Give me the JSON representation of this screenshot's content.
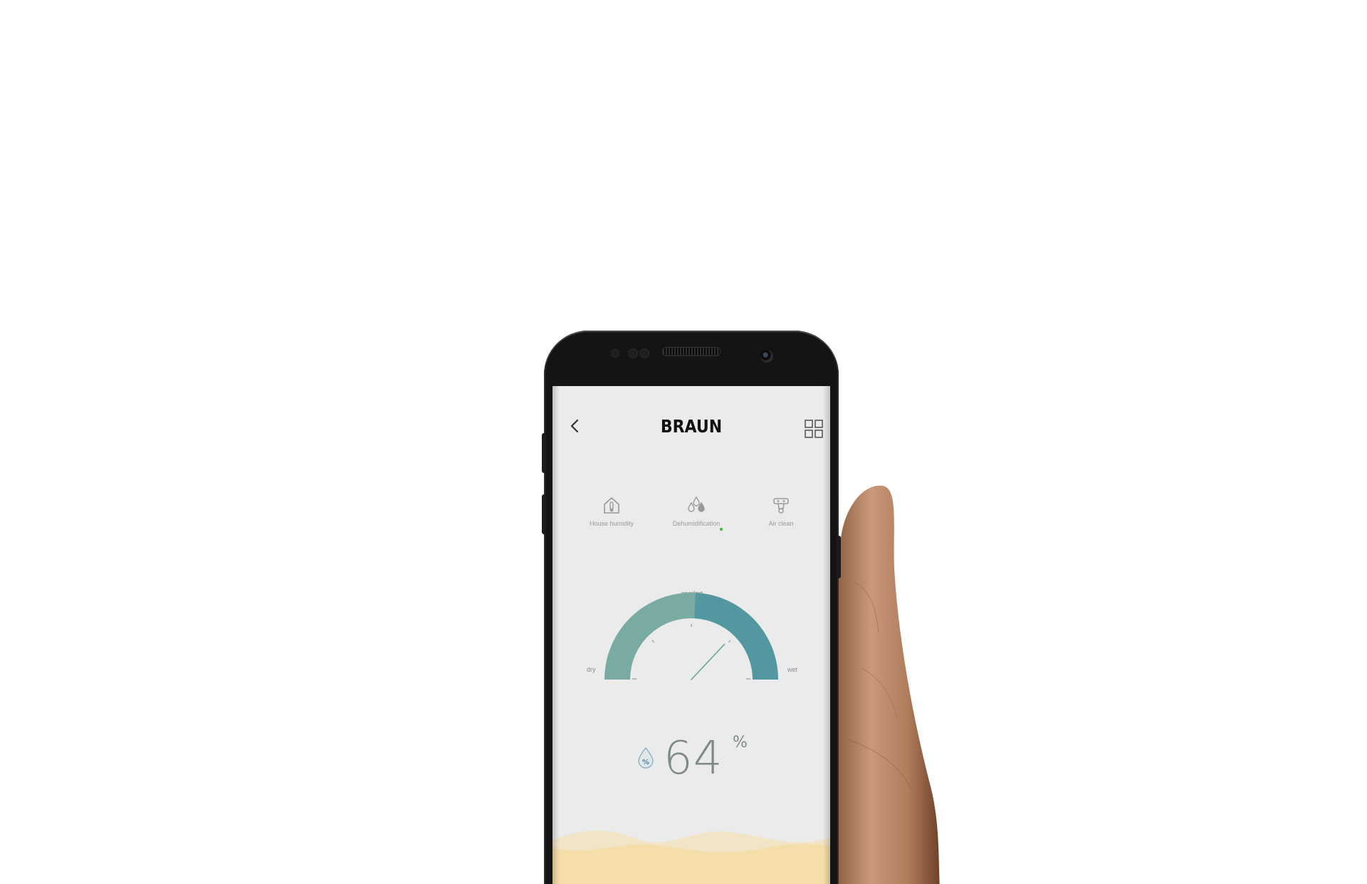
{
  "app": {
    "brand": "BRAUN"
  },
  "header": {
    "back_icon": "chevron-left-icon",
    "menu_icon": "grid-icon"
  },
  "modes": [
    {
      "label": "House humidity",
      "icon": "house-thermometer-icon",
      "active": false
    },
    {
      "label": "Dehumidification",
      "icon": "water-drops-icon",
      "active": true
    },
    {
      "label": "Air clean",
      "icon": "air-purifier-icon",
      "active": false
    }
  ],
  "gauge": {
    "top_label": "comfort",
    "left_label": "dry",
    "right_label": "wet",
    "needle_fraction": 0.74
  },
  "reading": {
    "value": "64",
    "unit": "%",
    "icon": "humidity-drop-icon"
  },
  "colors": {
    "screen_bg": "#ebebeb",
    "gauge_left": "#7aaba2",
    "gauge_right": "#5397a0",
    "active_dot": "#2dbf2d",
    "reading_text": "#7d8a89",
    "wave_fill": "#f6deaa"
  }
}
